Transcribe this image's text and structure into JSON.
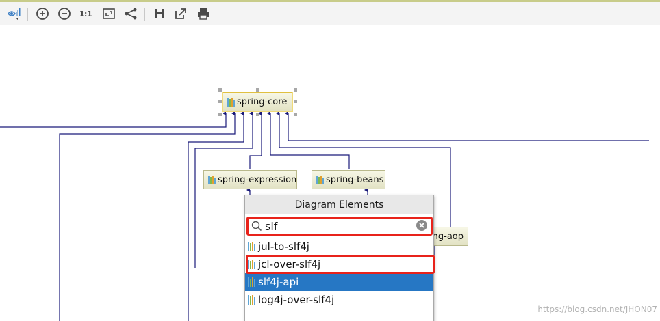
{
  "toolbar": {
    "zoom_actual_label": "1:1",
    "buttons": [
      "view-options",
      "zoom-in",
      "zoom-out",
      "actual-size",
      "fit-content",
      "layout",
      "save",
      "export",
      "print"
    ]
  },
  "diagram": {
    "nodes": {
      "spring_core": "spring-core",
      "spring_expression": "spring-expression",
      "spring_beans": "spring-beans",
      "spring_aop_partial": "ng-aop"
    }
  },
  "popup": {
    "title": "Diagram Elements",
    "search": {
      "value": "slf",
      "placeholder": ""
    },
    "items": [
      {
        "label": "jul-to-slf4j",
        "active": false
      },
      {
        "label": "jcl-over-slf4j",
        "active": false
      },
      {
        "label": "slf4j-api",
        "active": true
      },
      {
        "label": "log4j-over-slf4j",
        "active": false
      }
    ]
  },
  "watermark": "https://blog.csdn.net/JHON07",
  "colors": {
    "edge": "#1a1a7a",
    "node_border": "#b9b98c",
    "selection_highlight": "#2677c4",
    "annotation_red": "#e8231b",
    "library_icon": [
      "#5fa5d6",
      "#7fba4c",
      "#e0a030",
      "#5fa5d6"
    ]
  }
}
